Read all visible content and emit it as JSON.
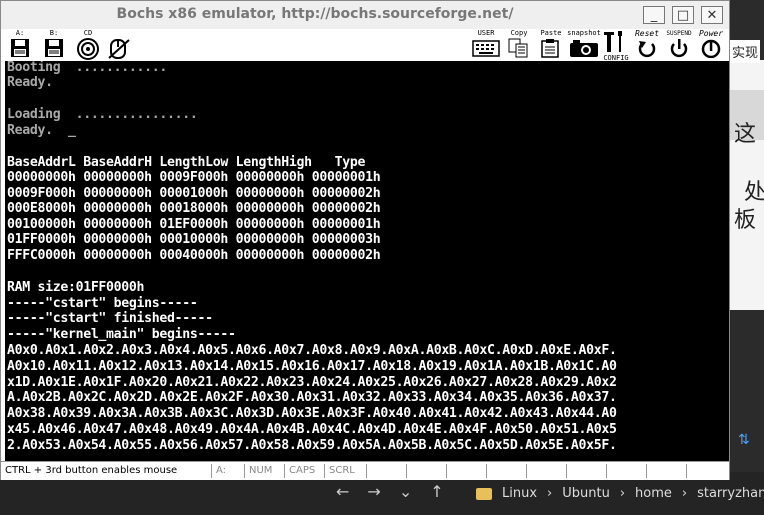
{
  "background": {
    "doc_side_text": "实现",
    "doc_chars": [
      "这",
      "处",
      "板"
    ],
    "nav": [
      "←",
      "→",
      "⌄",
      "↑"
    ],
    "path": [
      "Linux",
      "Ubuntu",
      "home",
      "starryzhang"
    ],
    "sort_icon": "⇅"
  },
  "window": {
    "title": "Bochs x86 emulator, http://bochs.sourceforge.net/",
    "buttons": {
      "minimize": "_",
      "maximize": "□",
      "close": "✕"
    }
  },
  "toolbar": {
    "left": [
      {
        "label": "A:",
        "icon": "floppy-a-icon"
      },
      {
        "label": "B:",
        "icon": "floppy-b-icon"
      },
      {
        "label": "CD",
        "icon": "cdrom-icon"
      },
      {
        "label": "",
        "icon": "mouse-icon"
      }
    ],
    "right": [
      {
        "label": "USER",
        "icon": "keyboard-icon"
      },
      {
        "label": "Copy",
        "icon": "copy-icon"
      },
      {
        "label": "Paste",
        "icon": "paste-icon"
      },
      {
        "label": "snapshot",
        "icon": "camera-icon"
      },
      {
        "label": "CONFIG",
        "icon": "config-icon"
      },
      {
        "label": "Reset",
        "icon": "reset-icon"
      },
      {
        "label": "SUSPEND",
        "icon": "suspend-icon"
      },
      {
        "label": "Power",
        "icon": "power-icon"
      }
    ]
  },
  "screen": {
    "lines": [
      {
        "text": "Booting  ............",
        "color": "gray"
      },
      {
        "text": "Ready.",
        "color": "gray"
      },
      {
        "text": "",
        "color": "gray"
      },
      {
        "text": "Loading  ................",
        "color": "gray"
      },
      {
        "text": "Ready.  _",
        "color": "gray"
      },
      {
        "text": "",
        "color": "gray"
      },
      {
        "text": "BaseAddrL BaseAddrH LengthLow LengthHigh   Type",
        "color": "white"
      },
      {
        "text": "00000000h 00000000h 0009F000h 00000000h 00000001h",
        "color": "white"
      },
      {
        "text": "0009F000h 00000000h 00001000h 00000000h 00000002h",
        "color": "white"
      },
      {
        "text": "000E8000h 00000000h 00018000h 00000000h 00000002h",
        "color": "white"
      },
      {
        "text": "00100000h 00000000h 01EF0000h 00000000h 00000001h",
        "color": "white"
      },
      {
        "text": "01FF0000h 00000000h 00010000h 00000000h 00000003h",
        "color": "white"
      },
      {
        "text": "FFFC0000h 00000000h 00040000h 00000000h 00000002h",
        "color": "white"
      },
      {
        "text": "",
        "color": "white"
      },
      {
        "text": "RAM size:01FF0000h",
        "color": "white"
      },
      {
        "text": "-----\"cstart\" begins-----",
        "color": "white"
      },
      {
        "text": "-----\"cstart\" finished-----",
        "color": "white"
      },
      {
        "text": "-----\"kernel_main\" begins-----",
        "color": "white"
      },
      {
        "text": "A0x0.A0x1.A0x2.A0x3.A0x4.A0x5.A0x6.A0x7.A0x8.A0x9.A0xA.A0xB.A0xC.A0xD.A0xE.A0xF.",
        "color": "white"
      },
      {
        "text": "A0x10.A0x11.A0x12.A0x13.A0x14.A0x15.A0x16.A0x17.A0x18.A0x19.A0x1A.A0x1B.A0x1C.A0",
        "color": "white"
      },
      {
        "text": "x1D.A0x1E.A0x1F.A0x20.A0x21.A0x22.A0x23.A0x24.A0x25.A0x26.A0x27.A0x28.A0x29.A0x2",
        "color": "white"
      },
      {
        "text": "A.A0x2B.A0x2C.A0x2D.A0x2E.A0x2F.A0x30.A0x31.A0x32.A0x33.A0x34.A0x35.A0x36.A0x37.",
        "color": "white"
      },
      {
        "text": "A0x38.A0x39.A0x3A.A0x3B.A0x3C.A0x3D.A0x3E.A0x3F.A0x40.A0x41.A0x42.A0x43.A0x44.A0",
        "color": "white"
      },
      {
        "text": "x45.A0x46.A0x47.A0x48.A0x49.A0x4A.A0x4B.A0x4C.A0x4D.A0x4E.A0x4F.A0x50.A0x51.A0x5",
        "color": "white"
      },
      {
        "text": "2.A0x53.A0x54.A0x55.A0x56.A0x57.A0x58.A0x59.A0x5A.A0x5B.A0x5C.A0x5D.A0x5E.A0x5F.",
        "color": "white"
      }
    ]
  },
  "statusbar": {
    "message": "CTRL + 3rd button enables mouse",
    "cells": [
      "A:",
      "NUM",
      "CAPS",
      "SCRL"
    ]
  }
}
